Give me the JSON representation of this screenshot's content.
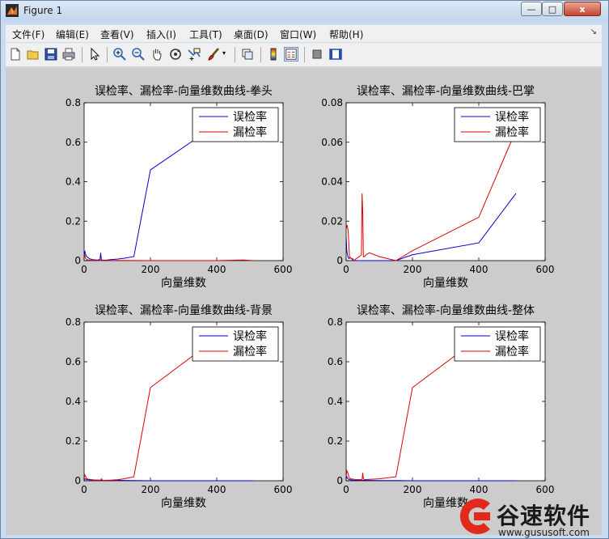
{
  "window": {
    "title": "Figure 1",
    "close_label": "x",
    "max_label": "□",
    "min_label": "—"
  },
  "menu": [
    "文件(F)",
    "编辑(E)",
    "查看(V)",
    "插入(I)",
    "工具(T)",
    "桌面(D)",
    "窗口(W)",
    "帮助(H)"
  ],
  "toolbar_icons": [
    "new-figure-icon",
    "open-icon",
    "save-icon",
    "print-icon",
    "pointer-icon",
    "zoom-in-icon",
    "zoom-out-icon",
    "pan-hand-icon",
    "rotate-3d-icon",
    "data-cursor-icon",
    "brush-icon",
    "link-plot-icon",
    "colorbar-icon",
    "legend-icon",
    "hide-plot-tools-icon",
    "show-plot-tools-icon"
  ],
  "colors": {
    "blue": "#0000cc",
    "red": "#dd0000",
    "axes_bg": "#ffffff",
    "figure_bg": "#cccccc"
  },
  "watermark": {
    "text": "谷速软件",
    "url": "www.gususoft.com"
  },
  "chart_data": [
    {
      "type": "line",
      "title": "误检率、漏检率-向量维数曲线-拳头",
      "xlabel": "向量维数",
      "ylabel": "",
      "xlim": [
        0,
        600
      ],
      "ylim": [
        0,
        0.8
      ],
      "xticks": [
        0,
        200,
        400,
        600
      ],
      "yticks": [
        0,
        0.2,
        0.4,
        0.6,
        0.8
      ],
      "legend_position": "top-right",
      "series": [
        {
          "name": "误检率",
          "color": "#0000cc",
          "x": [
            0,
            2,
            5,
            8,
            12,
            16,
            20,
            25,
            30,
            40,
            48,
            50,
            52,
            55,
            60,
            70,
            80,
            100,
            120,
            150,
            200,
            400,
            512
          ],
          "y": [
            0.01,
            0.05,
            0.03,
            0.02,
            0.015,
            0.01,
            0.008,
            0.005,
            0.004,
            0.003,
            0.005,
            0.04,
            0.005,
            0.003,
            0.002,
            0.003,
            0.005,
            0.008,
            0.012,
            0.02,
            0.46,
            0.69,
            0.71
          ]
        },
        {
          "name": "漏检率",
          "color": "#dd0000",
          "x": [
            0,
            2,
            5,
            10,
            20,
            30,
            50,
            100,
            200,
            400,
            450,
            480,
            500,
            512
          ],
          "y": [
            0.01,
            0.03,
            0.01,
            0.004,
            0.002,
            0.001,
            0.001,
            0.001,
            0.0,
            0.0,
            0.002,
            0.003,
            0.001,
            0.0
          ]
        }
      ]
    },
    {
      "type": "line",
      "title": "误检率、漏检率-向量维数曲线-巴掌",
      "xlabel": "向量维数",
      "ylabel": "",
      "xlim": [
        0,
        600
      ],
      "ylim": [
        0,
        0.08
      ],
      "xticks": [
        0,
        200,
        400,
        600
      ],
      "yticks": [
        0,
        0.02,
        0.04,
        0.06,
        0.08
      ],
      "legend_position": "top-right",
      "series": [
        {
          "name": "误检率",
          "color": "#0000cc",
          "x": [
            0,
            2,
            5,
            8,
            12,
            16,
            20,
            30,
            50,
            100,
            150,
            200,
            400,
            512
          ],
          "y": [
            0.012,
            0.005,
            0.002,
            0.001,
            0.0015,
            0.001,
            0.0,
            0.0,
            0.0,
            0.0,
            0.0,
            0.003,
            0.009,
            0.034
          ]
        },
        {
          "name": "漏检率",
          "color": "#dd0000",
          "x": [
            0,
            3,
            6,
            10,
            16,
            20,
            25,
            30,
            40,
            46,
            48,
            50,
            52,
            55,
            60,
            70,
            100,
            150,
            200,
            400,
            512
          ],
          "y": [
            0.016,
            0.018,
            0.015,
            0.002,
            0.001,
            0.001,
            0.0,
            0.001,
            0.002,
            0.003,
            0.034,
            0.025,
            0.002,
            0.002,
            0.003,
            0.004,
            0.002,
            0.0,
            0.005,
            0.022,
            0.066
          ]
        }
      ]
    },
    {
      "type": "line",
      "title": "误检率、漏检率-向量维数曲线-背景",
      "xlabel": "向量维数",
      "ylabel": "",
      "xlim": [
        0,
        600
      ],
      "ylim": [
        0,
        0.8
      ],
      "xticks": [
        0,
        200,
        400,
        600
      ],
      "yticks": [
        0,
        0.2,
        0.4,
        0.6,
        0.8
      ],
      "legend_position": "top-right",
      "series": [
        {
          "name": "误检率",
          "color": "#0000cc",
          "x": [
            0,
            2,
            5,
            10,
            20,
            30,
            50,
            100,
            150,
            200,
            400,
            512
          ],
          "y": [
            0.002,
            0.01,
            0.008,
            0.005,
            0.004,
            0.003,
            0.002,
            0.002,
            0.001,
            0.0,
            0.0,
            0.0
          ]
        },
        {
          "name": "漏检率",
          "color": "#dd0000",
          "x": [
            0,
            2,
            5,
            8,
            12,
            20,
            30,
            50,
            52,
            55,
            60,
            80,
            100,
            120,
            150,
            200,
            400,
            512
          ],
          "y": [
            0.01,
            0.03,
            0.02,
            0.01,
            0.008,
            0.006,
            0.004,
            0.003,
            0.01,
            0.003,
            0.002,
            0.003,
            0.005,
            0.01,
            0.02,
            0.47,
            0.72,
            0.74
          ]
        }
      ]
    },
    {
      "type": "line",
      "title": "误检率、漏检率-向量维数曲线-整体",
      "xlabel": "向量维数",
      "ylabel": "",
      "xlim": [
        0,
        600
      ],
      "ylim": [
        0,
        0.8
      ],
      "xticks": [
        0,
        200,
        400,
        600
      ],
      "yticks": [
        0,
        0.2,
        0.4,
        0.6,
        0.8
      ],
      "legend_position": "top-right",
      "series": [
        {
          "name": "误检率",
          "color": "#0000cc",
          "x": [
            0,
            2,
            5,
            10,
            20,
            30,
            50,
            100,
            150,
            200,
            400,
            512
          ],
          "y": [
            0.01,
            0.02,
            0.01,
            0.005,
            0.003,
            0.002,
            0.002,
            0.001,
            0.001,
            0.0,
            0.0,
            0.0
          ]
        },
        {
          "name": "漏检率",
          "color": "#dd0000",
          "x": [
            0,
            2,
            5,
            8,
            12,
            20,
            30,
            48,
            50,
            52,
            55,
            60,
            100,
            150,
            200,
            400,
            512
          ],
          "y": [
            0.02,
            0.05,
            0.04,
            0.02,
            0.01,
            0.008,
            0.006,
            0.005,
            0.04,
            0.01,
            0.005,
            0.006,
            0.01,
            0.02,
            0.47,
            0.72,
            0.76
          ]
        }
      ]
    }
  ]
}
